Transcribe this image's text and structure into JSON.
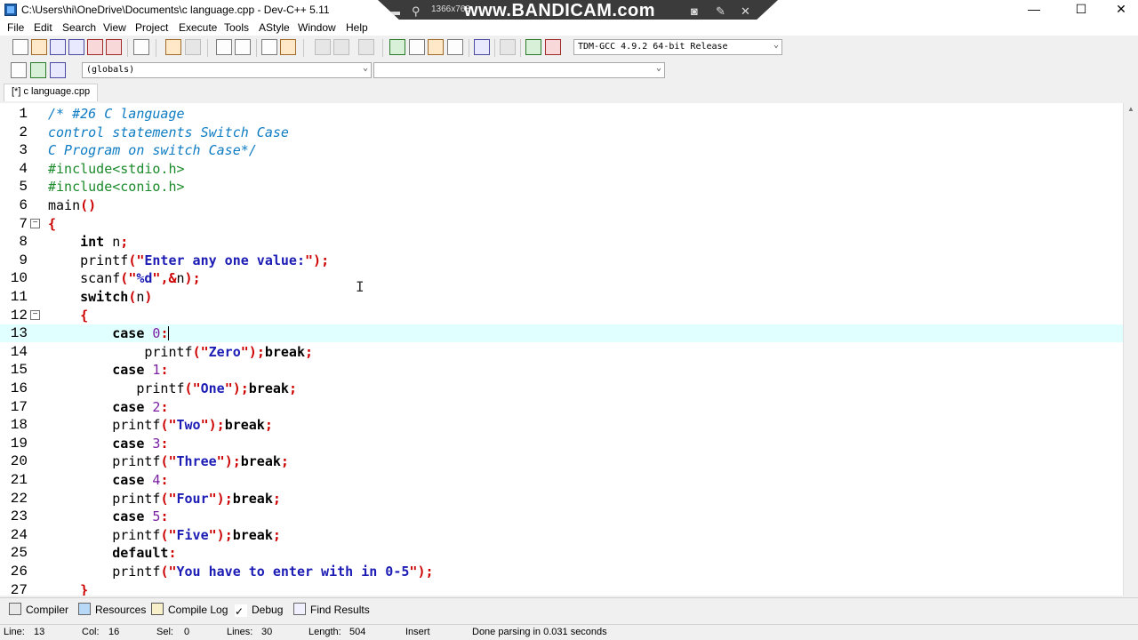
{
  "window": {
    "title": "C:\\Users\\hi\\OneDrive\\Documents\\c language.cpp - Dev-C++ 5.11",
    "minimize": "—",
    "maximize": "☐",
    "close": "✕"
  },
  "overlay": {
    "resolution": "1366x768",
    "watermark": "www.BANDICAM.com"
  },
  "menu": [
    "File",
    "Edit",
    "Search",
    "View",
    "Project",
    "Execute",
    "Tools",
    "AStyle",
    "Window",
    "Help"
  ],
  "toolbar": {
    "compiler": "TDM-GCC 4.9.2 64-bit Release",
    "scope": "(globals)",
    "function": ""
  },
  "tab": {
    "label": "[*] c language.cpp"
  },
  "editor": {
    "current_line": 13,
    "lines": [
      {
        "n": "1",
        "t": "/* #26 C language"
      },
      {
        "n": "2",
        "t": "control statements Switch Case"
      },
      {
        "n": "3",
        "t": "C Program on switch Case*/"
      },
      {
        "n": "4",
        "t": "#include<stdio.h>"
      },
      {
        "n": "5",
        "t": "#include<conio.h>"
      },
      {
        "n": "6",
        "t": "main()"
      },
      {
        "n": "7",
        "t": "{"
      },
      {
        "n": "8",
        "t": "    int n;"
      },
      {
        "n": "9",
        "t": "    printf(\"Enter any one value:\");"
      },
      {
        "n": "10",
        "t": "    scanf(\"%d\",&n);"
      },
      {
        "n": "11",
        "t": "    switch(n)"
      },
      {
        "n": "12",
        "t": "    {"
      },
      {
        "n": "13",
        "t": "        case 0:"
      },
      {
        "n": "14",
        "t": "            printf(\"Zero\");break;"
      },
      {
        "n": "15",
        "t": "        case 1:"
      },
      {
        "n": "16",
        "t": "           printf(\"One\");break;"
      },
      {
        "n": "17",
        "t": "        case 2:"
      },
      {
        "n": "18",
        "t": "        printf(\"Two\");break;"
      },
      {
        "n": "19",
        "t": "        case 3:"
      },
      {
        "n": "20",
        "t": "        printf(\"Three\");break;"
      },
      {
        "n": "21",
        "t": "        case 4:"
      },
      {
        "n": "22",
        "t": "        printf(\"Four\");break;"
      },
      {
        "n": "23",
        "t": "        case 5:"
      },
      {
        "n": "24",
        "t": "        printf(\"Five\");break;"
      },
      {
        "n": "25",
        "t": "        default:"
      },
      {
        "n": "26",
        "t": "        printf(\"You have to enter with in 0-5\");"
      },
      {
        "n": "27",
        "t": "    }"
      }
    ]
  },
  "bottom_tabs": {
    "compiler": "Compiler",
    "resources": "Resources",
    "compile_log": "Compile Log",
    "debug": "Debug",
    "find_results": "Find Results"
  },
  "status": {
    "line_label": "Line:",
    "line_value": "13",
    "col_label": "Col:",
    "col_value": "16",
    "sel_label": "Sel:",
    "sel_value": "0",
    "lines_label": "Lines:",
    "lines_value": "30",
    "length_label": "Length:",
    "length_value": "504",
    "mode": "Insert",
    "message": "Done parsing in 0.031 seconds"
  }
}
